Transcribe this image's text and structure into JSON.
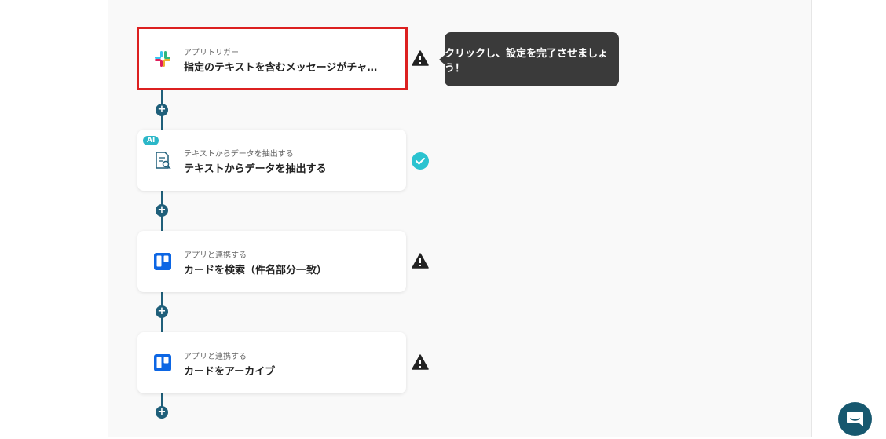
{
  "tooltip": {
    "text": "クリックし、設定を完了させましょう！"
  },
  "steps": [
    {
      "subtitle": "アプリトリガー",
      "title": "指定のテキストを含むメッセージがチャ…",
      "icon": "slack-icon",
      "status": "warning",
      "selected": true
    },
    {
      "subtitle": "テキストからデータを抽出する",
      "title": "テキストからデータを抽出する",
      "icon": "document-search-icon",
      "badge": "AI",
      "status": "complete"
    },
    {
      "subtitle": "アプリと連携する",
      "title": "カードを検索（件名部分一致）",
      "icon": "trello-icon",
      "status": "warning"
    },
    {
      "subtitle": "アプリと連携する",
      "title": "カードをアーカイブ",
      "icon": "trello-icon",
      "status": "warning"
    }
  ],
  "plus_label": "+",
  "colors": {
    "accent": "#1f5f7a",
    "selected_border": "#dc2020",
    "complete": "#2bc3d0",
    "tooltip_bg": "#3a3a3a"
  }
}
